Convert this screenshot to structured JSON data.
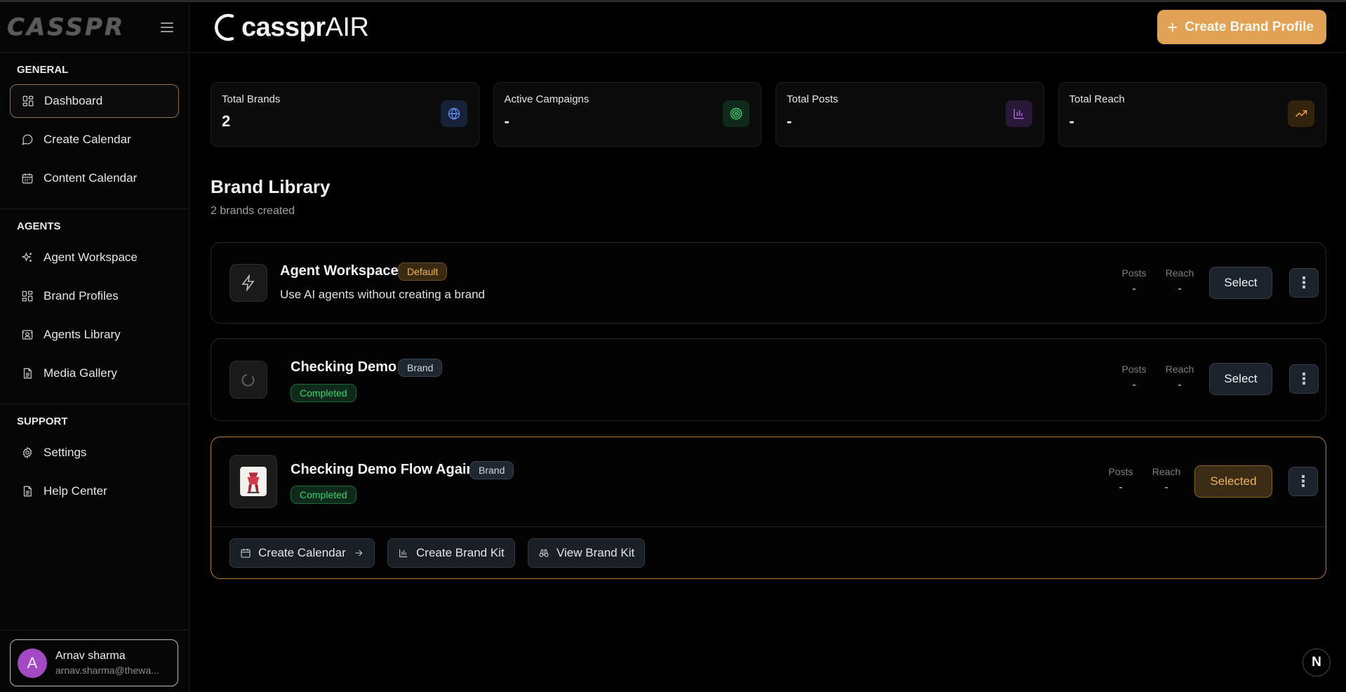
{
  "sidebar": {
    "logo": "CASSPR",
    "sections": [
      {
        "title": "GENERAL",
        "items": [
          {
            "label": "Dashboard",
            "icon": "dashboard-icon",
            "active": true
          },
          {
            "label": "Create Calendar",
            "icon": "chat-bubble-icon"
          },
          {
            "label": "Content Calendar",
            "icon": "calendar-icon"
          }
        ]
      },
      {
        "title": "AGENTS",
        "items": [
          {
            "label": "Agent Workspace",
            "icon": "sparkles-icon"
          },
          {
            "label": "Brand Profiles",
            "icon": "grid-icon"
          },
          {
            "label": "Agents Library",
            "icon": "library-icon"
          },
          {
            "label": "Media Gallery",
            "icon": "document-icon"
          }
        ]
      },
      {
        "title": "SUPPORT",
        "items": [
          {
            "label": "Settings",
            "icon": "gear-icon"
          },
          {
            "label": "Help Center",
            "icon": "document-icon"
          }
        ]
      }
    ],
    "user": {
      "initial": "A",
      "name": "Arnav sharma",
      "email": "arnav.sharma@thewa..."
    }
  },
  "header": {
    "brand_prefix": "casspr",
    "brand_suffix": "AIR",
    "create_button": "Create Brand Profile"
  },
  "stats": [
    {
      "label": "Total Brands",
      "value": "2",
      "icon": "globe-icon",
      "icon_bg": "#172238",
      "icon_color": "#5b8def"
    },
    {
      "label": "Active Campaigns",
      "value": "-",
      "icon": "target-icon",
      "icon_bg": "#0f2a1a",
      "icon_color": "#3fcf72"
    },
    {
      "label": "Total Posts",
      "value": "-",
      "icon": "bar-chart-icon",
      "icon_bg": "#2a1838",
      "icon_color": "#b06adf"
    },
    {
      "label": "Total Reach",
      "value": "-",
      "icon": "trending-up-icon",
      "icon_bg": "#33230c",
      "icon_color": "#f0a640"
    }
  ],
  "library": {
    "title": "Brand Library",
    "subtitle": "2 brands created",
    "metric_labels": {
      "posts": "Posts",
      "reach": "Reach"
    },
    "brands": [
      {
        "name": "Agent Workspace",
        "badge": "Default",
        "description": "Use AI agents without creating a brand",
        "posts": "-",
        "reach": "-",
        "button": "Select"
      },
      {
        "name": "Checking Demo",
        "badge": "Brand",
        "status": "Completed",
        "posts": "-",
        "reach": "-",
        "button": "Select"
      },
      {
        "name": "Checking Demo Flow Again",
        "badge": "Brand",
        "status": "Completed",
        "posts": "-",
        "reach": "-",
        "button": "Selected",
        "actions": [
          "Create Calendar",
          "Create Brand Kit",
          "View Brand Kit"
        ]
      }
    ]
  },
  "corner_badge": "N",
  "accent": "#e2a255"
}
